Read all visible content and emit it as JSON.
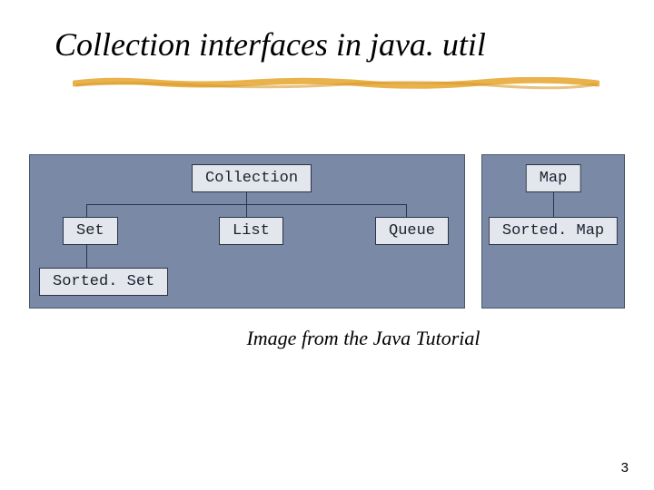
{
  "title": "Collection interfaces in java. util",
  "diagram": {
    "left_panel": {
      "root": "Collection",
      "children": [
        "Set",
        "List",
        "Queue"
      ],
      "grandchild_of_set": "Sorted. Set"
    },
    "right_panel": {
      "root": "Map",
      "child": "Sorted. Map"
    }
  },
  "caption": "Image from the Java Tutorial",
  "page_number": "3",
  "colors": {
    "panel_bg": "#7a8aa6",
    "node_bg": "#e3e6ec",
    "accent_underline": "#e9b24a"
  }
}
